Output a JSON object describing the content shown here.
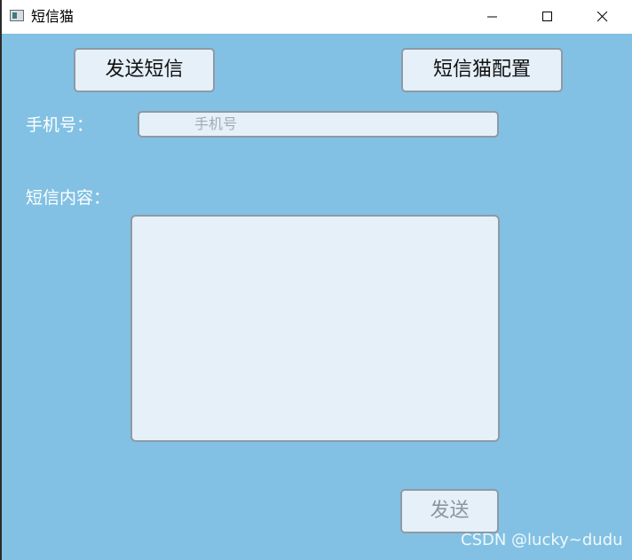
{
  "window": {
    "title": "短信猫",
    "minimize_icon": "minimize-icon",
    "maximize_icon": "maximize-icon",
    "close_icon": "close-icon"
  },
  "toolbar": {
    "send_sms_label": "发送短信",
    "config_label": "短信猫配置"
  },
  "form": {
    "phone_label": "手机号：",
    "phone_placeholder": "手机号",
    "phone_value": "",
    "content_label": "短信内容：",
    "content_value": "",
    "send_label": "发送"
  },
  "watermark": "CSDN @lucky~dudu",
  "colors": {
    "background": "#82c1e3",
    "control_fill": "#e5f0f9",
    "control_border": "#8d9aa6"
  }
}
